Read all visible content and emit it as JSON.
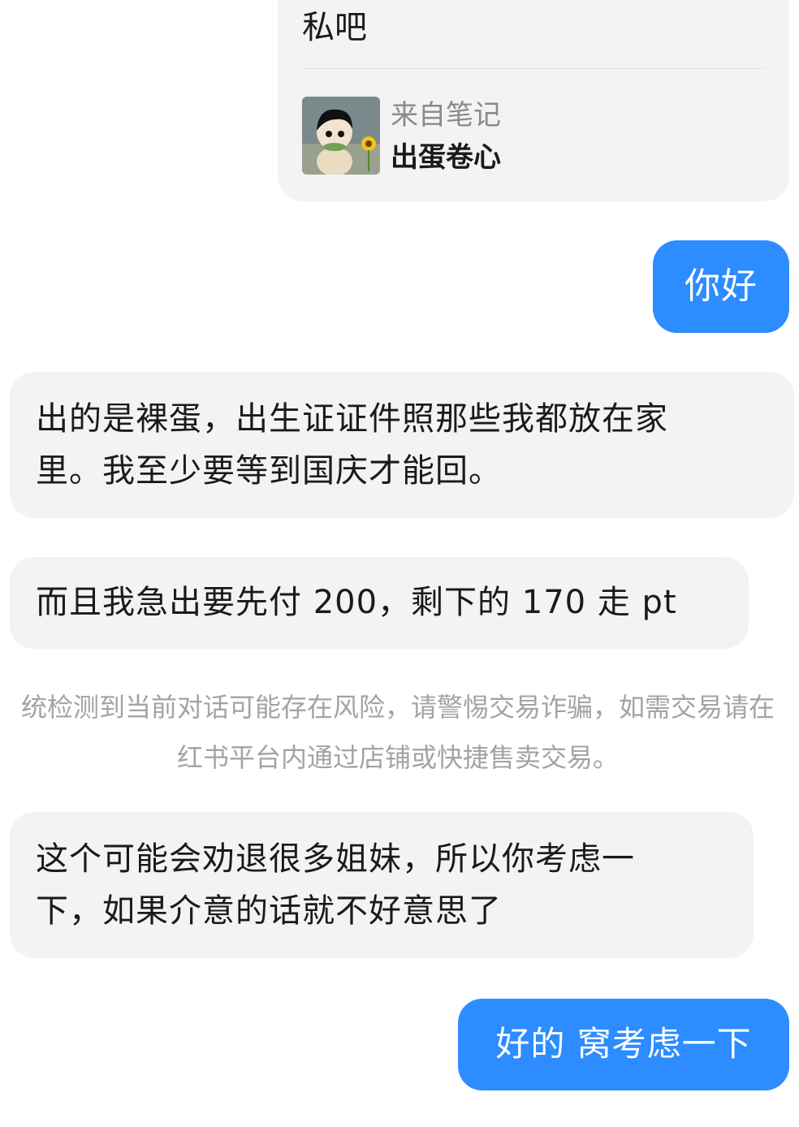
{
  "note_card": {
    "text": "私吧",
    "source_label": "来自笔记",
    "note_title": "出蛋卷心"
  },
  "messages": [
    {
      "id": "hello",
      "side": "right",
      "text": "你好"
    },
    {
      "id": "m1",
      "side": "left",
      "lines": [
        "出的是裸蛋，出生证证件照那些我都放在家",
        "里。我至少要等到国庆才能回。"
      ]
    },
    {
      "id": "m2",
      "side": "left",
      "text": "而且我急出要先付 200，剩下的 170 走 pt"
    },
    {
      "id": "m3",
      "side": "left",
      "lines": [
        "这个可能会劝退很多姐妹，所以你考虑一",
        "下，如果介意的话就不好意思了"
      ]
    },
    {
      "id": "ok",
      "side": "right",
      "text": "好的 窝考虑一下"
    }
  ],
  "system_warning": {
    "line1": "统检测到当前对话可能存在风险，请警惕交易诈骗，如需交易请在",
    "line2": "红书平台内通过店铺或快捷售卖交易。"
  },
  "colors": {
    "outgoing_bubble": "#2d8cff",
    "incoming_bubble": "#f3f3f4",
    "system_text": "#a3a3a7"
  }
}
